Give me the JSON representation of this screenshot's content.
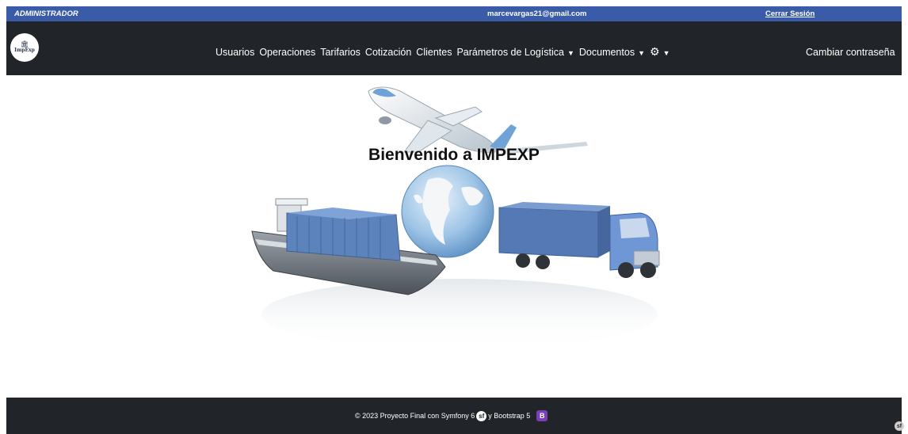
{
  "topbar": {
    "role": "ADMINISTRADOR",
    "email": "marcevargas21@gmail.com",
    "logout": "Cerrar Sesión"
  },
  "brand": {
    "icon": "building-icon",
    "name": "ImpExp"
  },
  "nav": {
    "items": [
      {
        "label": "Usuarios"
      },
      {
        "label": "Operaciones"
      },
      {
        "label": "Tarifarios"
      },
      {
        "label": "Cotización"
      },
      {
        "label": "Clientes"
      },
      {
        "label": "Parámetros de Logística"
      },
      {
        "label": "Documentos"
      }
    ],
    "settings_icon": "gear-icon",
    "change_password": "Cambiar contraseña"
  },
  "hero": {
    "title": "Bienvenido a IMPEXP",
    "image": "logistics-illustration"
  },
  "footer": {
    "text_before": "© 2023 Proyecto Final con Symfony 6",
    "text_middle": "y Bootstrap 5",
    "symfony_badge": "sf",
    "bootstrap_badge": "B"
  },
  "colors": {
    "topbar": "#3a5ca8",
    "navbar": "#212529",
    "footer": "#212529"
  }
}
